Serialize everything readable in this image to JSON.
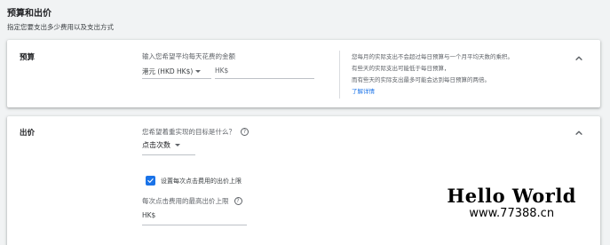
{
  "header": {
    "title": "预算和出价",
    "subtitle": "指定您要支出多少费用以及支出方式"
  },
  "budget": {
    "label": "预算",
    "field_label": "输入您希望平均每天花费的金额",
    "currency_select": "港元 (HKD HK$)",
    "amount_prefix": "HK$",
    "help": {
      "line1": "您每月的实际支出不会超过每日预算与一个月平均天数的乘积。",
      "line2": "有些天的实际支出可能低于每日预算，",
      "line3": "而有些天的实际支出最多可能会达到每日预算的两倍。",
      "link": "了解详情"
    }
  },
  "bidding": {
    "label": "出价",
    "question": "您希望着重实现的目标是什么？",
    "focus_value": "点击次数",
    "checkbox_label": "设置每次点击费用的出价上限",
    "checkbox_checked": true,
    "max_cpc_label": "每次点击费用的最高出价上限",
    "max_cpc_prefix": "HK$"
  },
  "watermark": {
    "title": "Hello World",
    "url": "www.77388.cn"
  },
  "colors": {
    "accent": "#1a73e8",
    "background": "#f1f3f4"
  }
}
